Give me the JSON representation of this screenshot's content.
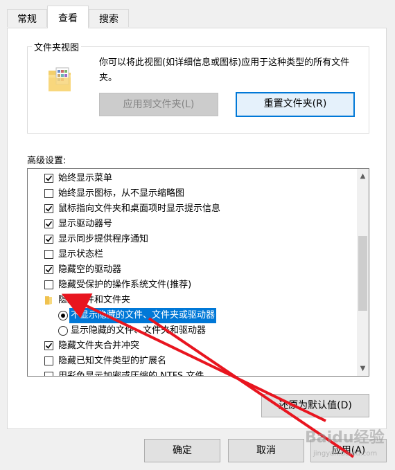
{
  "tabs": [
    {
      "label": "常规",
      "active": false
    },
    {
      "label": "查看",
      "active": true
    },
    {
      "label": "搜索",
      "active": false
    }
  ],
  "folder_views": {
    "title": "文件夹视图",
    "description": "你可以将此视图(如详细信息或图标)应用于这种类型的所有文件夹。",
    "apply_button": "应用到文件夹(L)",
    "reset_button": "重置文件夹(R)"
  },
  "advanced": {
    "label": "高级设置:",
    "items": [
      {
        "type": "checkbox",
        "checked": true,
        "label": "始终显示菜单"
      },
      {
        "type": "checkbox",
        "checked": false,
        "label": "始终显示图标，从不显示缩略图"
      },
      {
        "type": "checkbox",
        "checked": true,
        "label": "鼠标指向文件夹和桌面项时显示提示信息"
      },
      {
        "type": "checkbox",
        "checked": true,
        "label": "显示驱动器号"
      },
      {
        "type": "checkbox",
        "checked": true,
        "label": "显示同步提供程序通知"
      },
      {
        "type": "checkbox",
        "checked": false,
        "label": "显示状态栏"
      },
      {
        "type": "checkbox",
        "checked": true,
        "label": "隐藏空的驱动器"
      },
      {
        "type": "checkbox",
        "checked": false,
        "label": "隐藏受保护的操作系统文件(推荐)"
      },
      {
        "type": "folder",
        "label": "隐藏文件和文件夹"
      },
      {
        "type": "radio",
        "checked": true,
        "selected": true,
        "label": "不显示隐藏的文件、文件夹或驱动器"
      },
      {
        "type": "radio",
        "checked": false,
        "label": "显示隐藏的文件、文件夹和驱动器"
      },
      {
        "type": "checkbox",
        "checked": true,
        "label": "隐藏文件夹合并冲突"
      },
      {
        "type": "checkbox",
        "checked": false,
        "label": "隐藏已知文件类型的扩展名"
      },
      {
        "type": "checkbox",
        "checked": false,
        "label": "用彩色显示加密或压缩的 NTFS 文件"
      }
    ]
  },
  "restore_button": "还原为默认值(D)",
  "footer": {
    "ok": "确定",
    "cancel": "取消",
    "apply": "应用(A)"
  },
  "watermark": {
    "text": "Baidu经验",
    "sub": "jingyan.baidu.com"
  },
  "colors": {
    "accent": "#0078d7",
    "annotation_arrow": "#e8151f"
  }
}
